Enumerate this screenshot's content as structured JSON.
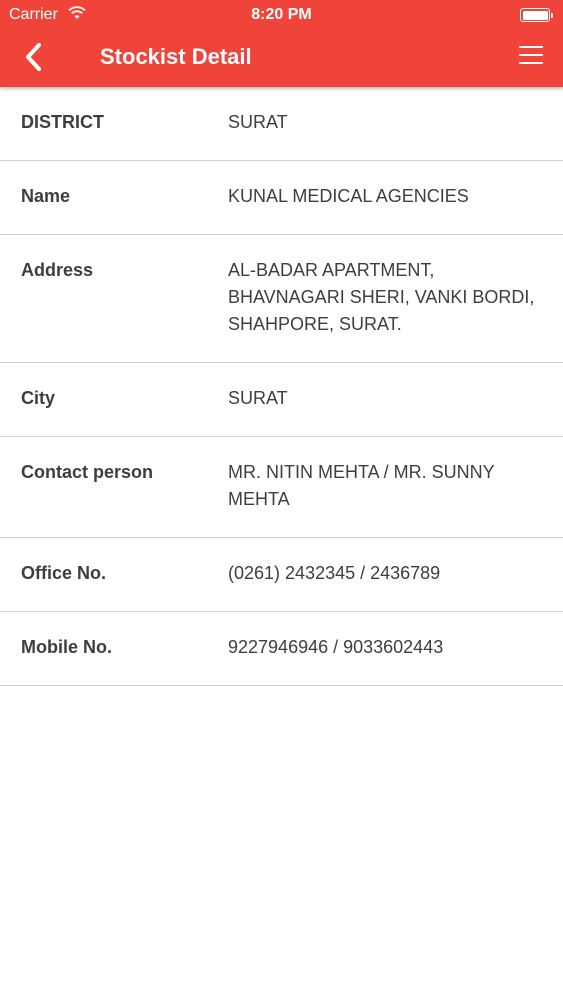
{
  "status_bar": {
    "carrier": "Carrier",
    "time": "8:20 PM"
  },
  "app_bar": {
    "title": "Stockist Detail",
    "back_icon": "chevron-left-icon",
    "menu_icon": "hamburger-menu-icon"
  },
  "colors": {
    "primary": "#f0443a",
    "text": "#3e3e3e",
    "divider": "#cfcfcf"
  },
  "details": [
    {
      "label": "DISTRICT",
      "value": "SURAT"
    },
    {
      "label": "Name",
      "value": "KUNAL MEDICAL AGENCIES"
    },
    {
      "label": "Address",
      "value": "AL-BADAR APARTMENT, BHAVNAGARI SHERI, VANKI BORDI, SHAHPORE, SURAT."
    },
    {
      "label": "City",
      "value": "SURAT"
    },
    {
      "label": "Contact person",
      "value": "MR. NITIN MEHTA / MR. SUNNY MEHTA"
    },
    {
      "label": "Office No.",
      "value": "(0261) 2432345 / 2436789"
    },
    {
      "label": "Mobile No.",
      "value": "9227946946 / 9033602443"
    }
  ]
}
